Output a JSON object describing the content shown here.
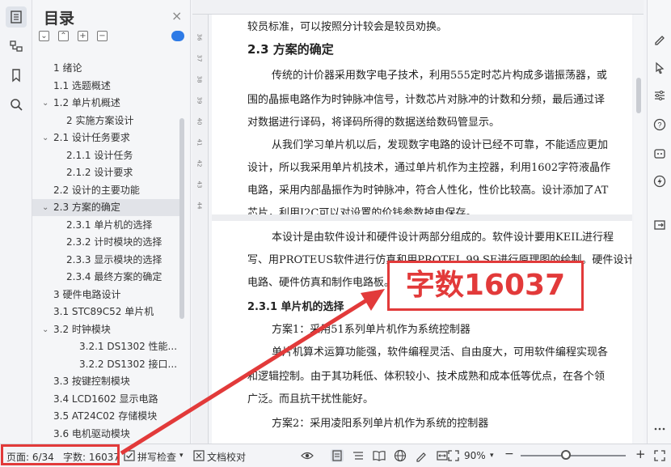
{
  "toc": {
    "title": "目录",
    "close": "×",
    "controls": [
      "⌄",
      "⌃",
      "+",
      "−"
    ],
    "items": [
      {
        "label": "1  绪论",
        "level": 0,
        "caret": ""
      },
      {
        "label": "1.1  选题概述",
        "level": 0,
        "caret": ""
      },
      {
        "label": "1.2  单片机概述",
        "level": 0,
        "caret": "⌄"
      },
      {
        "label": "2  实施方案设计",
        "level": 1,
        "caret": ""
      },
      {
        "label": "2.1  设计任务要求",
        "level": 0,
        "caret": "⌄"
      },
      {
        "label": "2.1.1  设计任务",
        "level": 1,
        "caret": ""
      },
      {
        "label": "2.1.2  设计要求",
        "level": 1,
        "caret": ""
      },
      {
        "label": "2.2  设计的主要功能",
        "level": 0,
        "caret": ""
      },
      {
        "label": "2.3  方案的确定",
        "level": 0,
        "caret": "⌄",
        "selected": true
      },
      {
        "label": "2.3.1  单片机的选择",
        "level": 1,
        "caret": ""
      },
      {
        "label": "2.3.2  计时模块的选择",
        "level": 1,
        "caret": ""
      },
      {
        "label": "2.3.3  显示模块的选择",
        "level": 1,
        "caret": ""
      },
      {
        "label": "2.3.4  最终方案的确定",
        "level": 1,
        "caret": ""
      },
      {
        "label": "3  硬件电路设计",
        "level": 0,
        "caret": ""
      },
      {
        "label": "3.1  STC89C52 单片机",
        "level": 0,
        "caret": ""
      },
      {
        "label": "3.2  时钟模块",
        "level": 0,
        "caret": "⌄"
      },
      {
        "label": "3.2.1  DS1302 性能...",
        "level": 2,
        "caret": ""
      },
      {
        "label": "3.2.2  DS1302 接口...",
        "level": 2,
        "caret": ""
      },
      {
        "label": "3.3  按键控制模块",
        "level": 0,
        "caret": ""
      },
      {
        "label": "3.4  LCD1602 显示电路",
        "level": 0,
        "caret": ""
      },
      {
        "label": "3.5  AT24C02 存储模块",
        "level": 0,
        "caret": ""
      },
      {
        "label": "3.6  电机驱动模块",
        "level": 0,
        "caret": ""
      }
    ]
  },
  "document": {
    "lines": [
      {
        "text": "较员标准，可以按照分计较会是较员劝换。",
        "kind": "body"
      },
      {
        "text": "2.3  方案的确定",
        "kind": "heading"
      },
      {
        "text": "传统的计价器采用数字电子技术，利用555定时芯片构成多谐振荡器，或",
        "kind": "body-indent"
      },
      {
        "text": "围的晶振电路作为时钟脉冲信号，计数芯片对脉冲的计数和分频，最后通过译",
        "kind": "body"
      },
      {
        "text": "对数据进行译码，将译码所得的数据送给数码管显示。",
        "kind": "body"
      },
      {
        "text": "从我们学习单片机以后，发现数字电路的设计已经不可靠，不能适应更加",
        "kind": "body-indent"
      },
      {
        "text": "设计，所以我采用单片机技术，通过单片机作为主控器，利用1602字符液晶作",
        "kind": "body"
      },
      {
        "text": "电路，采用内部晶振作为时钟脉冲，符合人性化，性价比较高。设计添加了AT",
        "kind": "body"
      },
      {
        "text": "芯片，利用I2C可以对设置的价钱参数掉电保存。",
        "kind": "body"
      },
      {
        "text": "本设计是由软件设计和硬件设计两部分组成的。软件设计要用KEIL进行程",
        "kind": "body-indent"
      },
      {
        "text": "写、用PROTEUS软件进行仿真和用PROTEL 99 SE进行原理图的绘制。硬件设计",
        "kind": "body"
      },
      {
        "text": "电路、硬件仿真和制作电路板。",
        "kind": "body"
      },
      {
        "text": "2.3.1  单片机的选择",
        "kind": "subheading"
      },
      {
        "text": "方案1：采用51系列单片机作为系统控制器",
        "kind": "body-indent"
      },
      {
        "text": "单片机算术运算功能强，软件编程灵活、自由度大，可用软件编程实现各",
        "kind": "body-indent"
      },
      {
        "text": "和逻辑控制。由于其功耗低、体积较小、技术成熟和成本低等优点，在各个领",
        "kind": "body"
      },
      {
        "text": "广泛。而且抗干扰性能好。",
        "kind": "body"
      },
      {
        "text": "方案2：采用凌阳系列单片机作为系统的控制器",
        "kind": "body-indent"
      }
    ],
    "ruler_left_numbers": [
      "36",
      "37",
      "38",
      "39",
      "40",
      "41",
      "42",
      "43",
      "44"
    ]
  },
  "status": {
    "page": "页面: 6/34",
    "words": "字数: 16037",
    "spell_check": "拼写检查",
    "doc_check": "文档校对",
    "zoom": "90%",
    "zoom_minus": "−",
    "zoom_plus": "+"
  },
  "annotation": {
    "callout": "字数16037",
    "color": "#e23a3a"
  }
}
